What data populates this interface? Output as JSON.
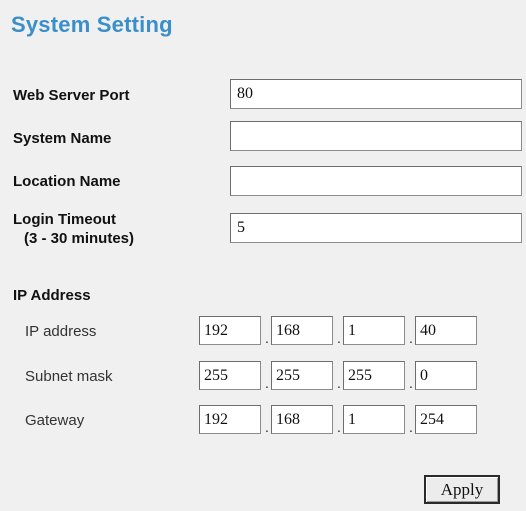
{
  "page": {
    "title": "System Setting"
  },
  "form": {
    "web_server_port": {
      "label": "Web Server Port",
      "value": "80"
    },
    "system_name": {
      "label": "System Name",
      "value": ""
    },
    "location_name": {
      "label": "Location Name",
      "value": ""
    },
    "login_timeout": {
      "label": "Login Timeout",
      "sublabel": "(3 - 30 minutes)",
      "value": "5"
    }
  },
  "ip_section": {
    "heading": "IP Address",
    "dot": ".",
    "ip_address": {
      "label": "IP address",
      "octets": [
        "192",
        "168",
        "1",
        "40"
      ]
    },
    "subnet_mask": {
      "label": "Subnet mask",
      "octets": [
        "255",
        "255",
        "255",
        "0"
      ]
    },
    "gateway": {
      "label": "Gateway",
      "octets": [
        "192",
        "168",
        "1",
        "254"
      ]
    }
  },
  "actions": {
    "apply_label": "Apply"
  }
}
